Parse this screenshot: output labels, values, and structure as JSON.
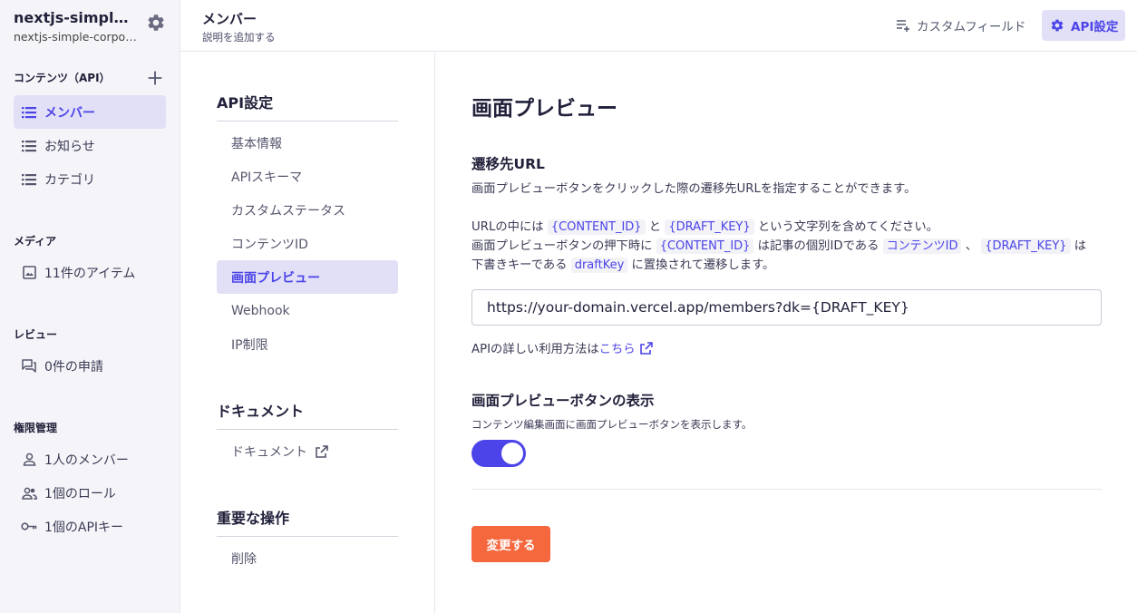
{
  "service": {
    "name": "nextjs-simple-...",
    "id": "nextjs-simple-corpora..."
  },
  "sidebar": {
    "content_heading": "コンテンツ（API）",
    "content_items": [
      {
        "label": "メンバー",
        "icon": "list-icon",
        "active": true
      },
      {
        "label": "お知らせ",
        "icon": "list-icon"
      },
      {
        "label": "カテゴリ",
        "icon": "list-icon"
      }
    ],
    "media_heading": "メディア",
    "media_item": {
      "label": "11件のアイテム",
      "icon": "image-icon"
    },
    "review_heading": "レビュー",
    "review_item": {
      "label": "0件の申請",
      "icon": "comments-icon"
    },
    "permission_heading": "権限管理",
    "permission_items": [
      {
        "label": "1人のメンバー",
        "icon": "person-icon"
      },
      {
        "label": "1個のロール",
        "icon": "people-icon"
      },
      {
        "label": "1個のAPIキー",
        "icon": "key-icon"
      }
    ]
  },
  "header": {
    "title": "メンバー",
    "description": "説明を追加する",
    "custom_field_label": "カスタムフィールド",
    "api_settings_label": "API設定"
  },
  "settings_menu": {
    "api_heading": "API設定",
    "api_items": [
      "基本情報",
      "APIスキーマ",
      "カスタムステータス",
      "コンテンツID",
      "画面プレビュー",
      "Webhook",
      "IP制限"
    ],
    "active_index": 4,
    "doc_heading": "ドキュメント",
    "doc_item": "ドキュメント",
    "danger_heading": "重要な操作",
    "danger_item": "削除"
  },
  "main": {
    "title": "画面プレビュー",
    "url_heading": "遷移先URL",
    "url_desc": "画面プレビューボタンをクリックした際の遷移先URLを指定することができます。",
    "line1_prefix": "URLの中には",
    "content_id_token": "{CONTENT_ID}",
    "and_text": "と",
    "draft_key_token": "{DRAFT_KEY}",
    "line1_suffix": "という文字列を含めてください。",
    "line2_prefix": "画面プレビューボタンの押下時に",
    "line2_mid1": "は記事の個別IDである",
    "content_id_name": "コンテンツID",
    "comma": "、",
    "line2_mid2": "は",
    "line3_prefix": "下書きキーである",
    "draft_key_name": "draftKey",
    "line3_suffix": "に置換されて遷移します。",
    "url_value": "https://your-domain.vercel.app/members?dk={DRAFT_KEY}",
    "api_detail_prefix": "APIの詳しい利用方法は",
    "api_detail_link": "こちら",
    "display_heading": "画面プレビューボタンの表示",
    "display_desc": "コンテンツ編集画面に画面プレビューボタンを表示します。",
    "toggle_on": true,
    "submit_label": "変更する"
  },
  "colors": {
    "accent": "#4c44e8",
    "accent_bg": "#e1e0f7",
    "submit": "#f5683e",
    "sidebar_bg": "#f5f5f9"
  }
}
